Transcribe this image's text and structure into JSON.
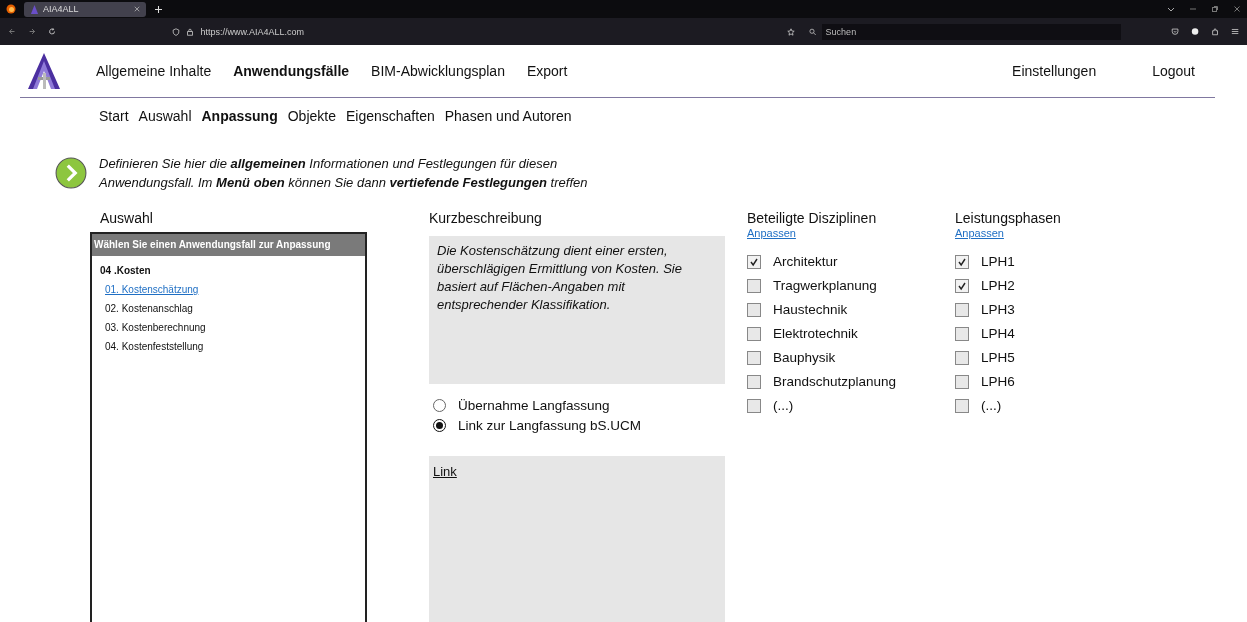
{
  "browser": {
    "tab": {
      "title": "AIA4ALL",
      "selected": true
    },
    "url": "https://www.AIA4ALL.com",
    "search": {
      "placeholder": "Suchen"
    }
  },
  "nav": {
    "items": [
      {
        "label": "Allgemeine Inhalte",
        "selected": false
      },
      {
        "label": "Anwendungsfälle",
        "selected": true
      },
      {
        "label": "BIM-Abwicklungsplan",
        "selected": false
      },
      {
        "label": "Export",
        "selected": false
      }
    ],
    "right": [
      "Einstellungen",
      "Logout"
    ]
  },
  "subnav": [
    {
      "label": "Start",
      "selected": false
    },
    {
      "label": "Auswahl",
      "selected": false
    },
    {
      "label": "Anpassung",
      "selected": true
    },
    {
      "label": "Objekte",
      "selected": false
    },
    {
      "label": "Eigenschaften",
      "selected": false
    },
    {
      "label": "Phasen und Autoren",
      "selected": false
    }
  ],
  "intro": "Definieren Sie hier die **allgemeinen** Informationen und Festlegungen für diesen Anwendungsfall. Im **Menü oben** können Sie dann **vertiefende Festlegungen** treffen",
  "auswahl": {
    "heading": "Auswahl",
    "header": "Wählen Sie einen Anwendungsfall zur Anpassung",
    "group": "04 .Kosten",
    "items": [
      {
        "label": "01. Kostenschätzung",
        "selected": true
      },
      {
        "label": "02. Kostenanschlag",
        "selected": false
      },
      {
        "label": "03. Kostenberechnung",
        "selected": false
      },
      {
        "label": "04. Kostenfeststellung",
        "selected": false
      }
    ]
  },
  "kurzbeschreibung": {
    "heading": "Kurzbeschreibung",
    "text": "Die Kostenschätzung dient einer ersten, überschlägigen Ermittlung von Kosten. Sie basiert auf Flächen-Angaben mit entsprechender Klassifikation.",
    "options": [
      {
        "label": "Übernahme Langfassung",
        "selected": false
      },
      {
        "label": "Link zur Langfassung bS.UCM",
        "selected": true
      }
    ],
    "link": "Link"
  },
  "disziplinen": {
    "heading": "Beteiligte Disziplinen",
    "action": "Anpassen",
    "items": [
      {
        "label": "Architektur",
        "checked": true
      },
      {
        "label": "Tragwerkplanung",
        "checked": false
      },
      {
        "label": "Haustechnik",
        "checked": false
      },
      {
        "label": "Elektrotechnik",
        "checked": false
      },
      {
        "label": "Bauphysik",
        "checked": false
      },
      {
        "label": "Brandschutzplanung",
        "checked": false
      },
      {
        "label": "(...)",
        "checked": false
      }
    ]
  },
  "leistungsphasen": {
    "heading": "Leistungsphasen",
    "action": "Anpassen",
    "items": [
      {
        "label": "LPH1",
        "checked": true
      },
      {
        "label": "LPH2",
        "checked": true
      },
      {
        "label": "LPH3",
        "checked": false
      },
      {
        "label": "LPH4",
        "checked": false
      },
      {
        "label": "LPH5",
        "checked": false
      },
      {
        "label": "LPH6",
        "checked": false
      },
      {
        "label": "(...)",
        "checked": false
      }
    ]
  }
}
